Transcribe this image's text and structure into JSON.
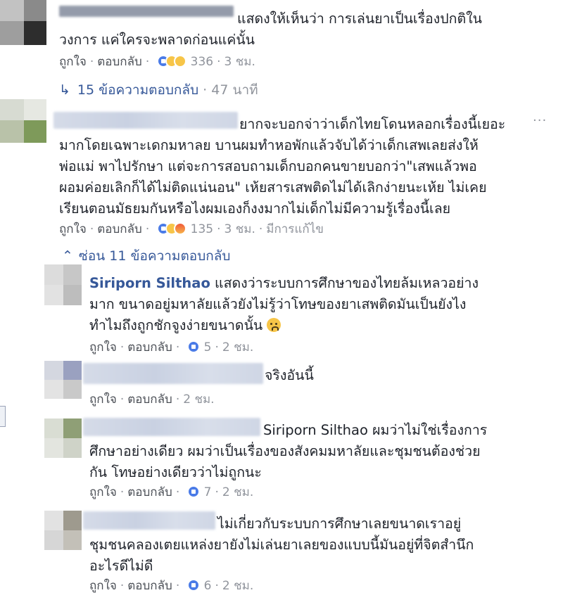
{
  "comments": [
    {
      "lines": [
        "แสดงให้เห็นว่า การเล่นยาเป็นเรื่องปกติใน",
        "วงการ แค่ใครจะพลาดก่อนแค่นั้น"
      ],
      "like": "ถูกใจ",
      "reply": "ตอบกลับ",
      "count": "336",
      "time": "3 ชม."
    },
    {
      "lines": [
        "ยากจะบอกจ่าว่าเด็กไทยโดนหลอกเรื่องนี้เยอะ",
        "มากโดยเฉพาะเดกมหาลย บานผมทำหอพักแล้วจับได้ว่าเด็กเสพเลยส่งให้",
        "พ่อแม่ พาไปรักษา แต่จะการสอบถามเด็กบอกคนขายบอกว่า\"เสพแล้วพอ",
        "ผอมค่อยเลิกก็ได้ไม่ติดแน่นอน\" เห้ยสารเสพติดไม่ได้เลิกง่ายนะเห้ย ไม่เคย",
        "เรียนตอนมัธยมกันหรือไงผมเองก็งงมากไม่เด็กไม่มีความรู้เรื่องนี้เลย"
      ],
      "like": "ถูกใจ",
      "reply": "ตอบกลับ",
      "count": "135",
      "time": "3 ชม.",
      "edited": "มีการแก้ไข"
    }
  ],
  "replies_collapsed": {
    "label": "15 ข้อความตอบกลับ",
    "time": "47 นาที"
  },
  "replies_expanded": {
    "label": "ซ่อน 11 ข้อความตอบกลับ"
  },
  "replies": [
    {
      "name": "Siriporn Silthao",
      "lines": [
        "แสดงว่าระบบการศึกษาของไทยล้มเหลวอย่าง",
        "มาก ขนาดอยู่มหาลัยแล้วยังไม่รู้ว่าโทษของยาเสพติดมันเป็นยังไง",
        "ทำไมถึงถูกชักจูงง่ายขนาดนั้น"
      ],
      "like": "ถูกใจ",
      "reply": "ตอบกลับ",
      "count": "5",
      "time": "2 ชม."
    },
    {
      "lines": [
        "จริงอันนี้"
      ],
      "like": "ถูกใจ",
      "reply": "ตอบกลับ",
      "time": "2 ชม."
    },
    {
      "lines": [
        "Siriporn Silthao ผมว่าไม่ใช่เรื่องการ",
        "ศึกษาอย่างเดียว ผมว่าเป็นเรื่องของสังคมมหาลัยและชุมชนต้องช่วย",
        "กัน โทษอย่างเดียวว่าไม่ถูกนะ"
      ],
      "like": "ถูกใจ",
      "reply": "ตอบกลับ",
      "count": "7",
      "time": "2 ชม."
    },
    {
      "lines": [
        "ไม่เกี่ยวกับระบบการศึกษาเลยขนาดเราอยู่",
        "ชุมชนคลองเตยแหล่งยายังไม่เล่นยาเลยของแบบนี้มันอยู่ที่จิตสำนึก",
        "อะไรดีไม่ดี"
      ],
      "like": "ถูกใจ",
      "reply": "ตอบกลับ",
      "count": "6",
      "time": "2 ชม."
    }
  ]
}
